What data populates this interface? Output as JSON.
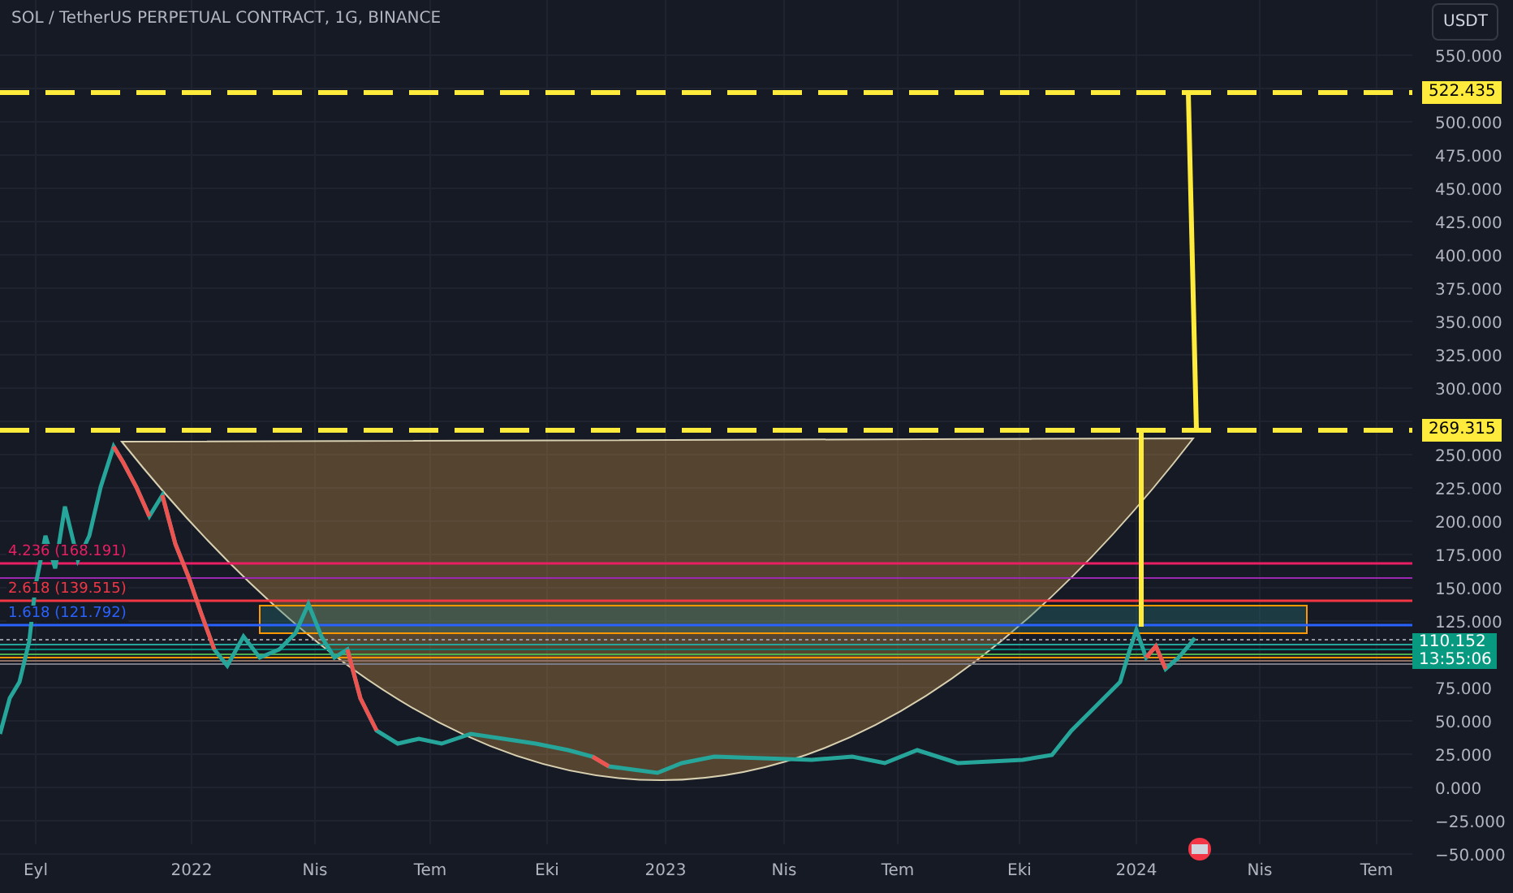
{
  "title": "SOL / TetherUS PERPETUAL CONTRACT, 1G, BINANCE",
  "currency_button": "USDT",
  "price_axis": {
    "ticks": [
      "550.000",
      "500.000",
      "475.000",
      "450.000",
      "425.000",
      "400.000",
      "375.000",
      "350.000",
      "325.000",
      "300.000",
      "250.000",
      "225.000",
      "200.000",
      "175.000",
      "150.000",
      "125.000",
      "75.000",
      "50.000",
      "25.000",
      "0.000",
      "−25.000",
      "−50.000"
    ]
  },
  "level_lines": [
    {
      "label": "522.435",
      "color": "#ffeb3b"
    },
    {
      "label": "269.315",
      "color": "#ffeb3b"
    }
  ],
  "fib_levels": [
    {
      "label": "4.236 (168.191)",
      "color": "#e91e63"
    },
    {
      "label": "2.618 (139.515)",
      "color": "#f23645"
    },
    {
      "label": "1.618 (121.792)",
      "color": "#2962ff"
    }
  ],
  "last_price": {
    "price": "110.152",
    "countdown": "13:55:06",
    "color": "#089981"
  },
  "time_axis": [
    "Eyl",
    "2022",
    "Nis",
    "Tem",
    "Eki",
    "2023",
    "Nis",
    "Tem",
    "Eki",
    "2024",
    "Nis",
    "Tem"
  ]
}
